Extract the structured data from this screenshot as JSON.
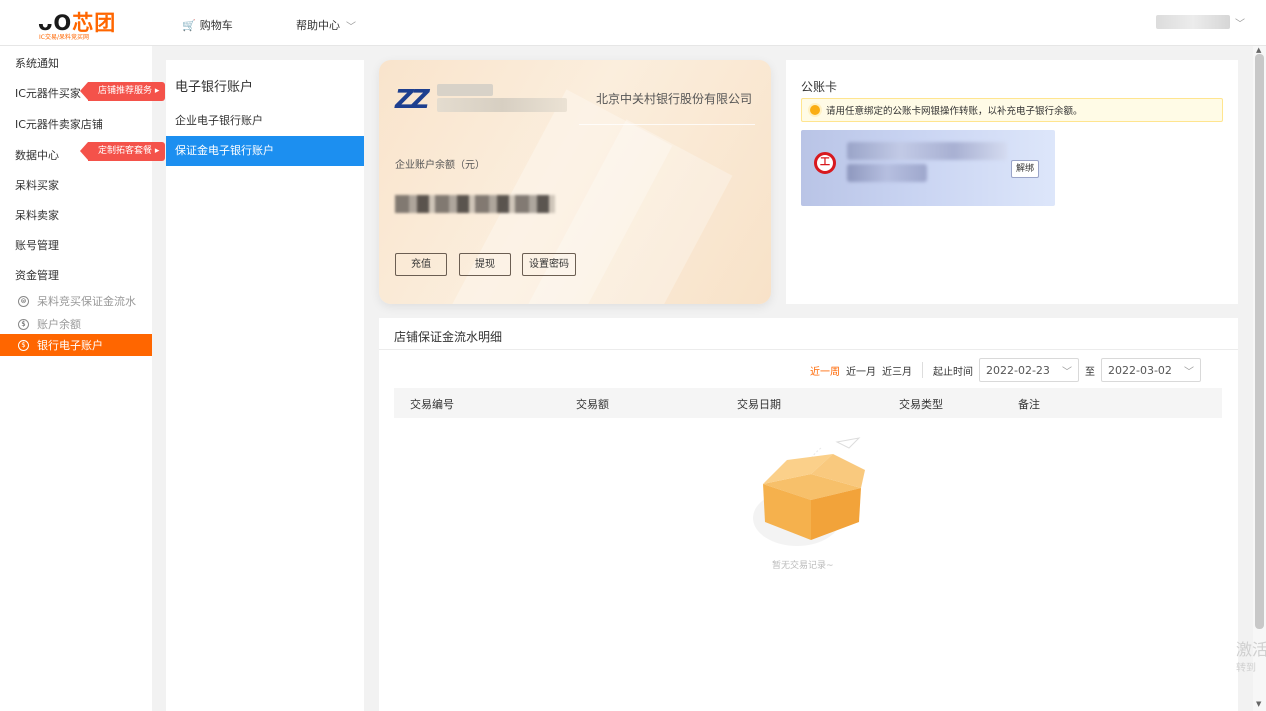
{
  "header": {
    "logo_text": "芯团",
    "logo_sub": "IC交易/呆料竞买网",
    "cart_label": "购物车",
    "help_label": "帮助中心"
  },
  "leftnav": {
    "items": [
      {
        "label": "系统通知"
      },
      {
        "label": "IC元器件买家",
        "tag": "店铺推荐服务 ▸"
      },
      {
        "label": "IC元器件卖家店铺"
      },
      {
        "label": "数据中心",
        "tag": "定制拓客套餐 ▸"
      },
      {
        "label": "呆料买家"
      },
      {
        "label": "呆料卖家"
      },
      {
        "label": "账号管理"
      },
      {
        "label": "资金管理"
      }
    ],
    "sub_items": [
      {
        "label": "呆料竞买保证金流水"
      },
      {
        "label": "账户余额"
      },
      {
        "label": "银行电子账户"
      }
    ]
  },
  "midpanel": {
    "title": "电子银行账户",
    "items": [
      {
        "label": "企业电子银行账户"
      },
      {
        "label": "保证金电子银行账户"
      }
    ]
  },
  "bankcard": {
    "bank_name": "北京中关村银行股份有限公司",
    "balance_label": "企业账户余额（元）",
    "buttons": [
      "充值",
      "提现",
      "设置密码"
    ]
  },
  "public_account": {
    "title": "公账卡",
    "notice": "请用任意绑定的公账卡网银操作转账，以补充电子银行余额。",
    "unbind_label": "解绑"
  },
  "detail": {
    "title": "店铺保证金流水明细",
    "quick_filters": [
      "近一周",
      "近一月",
      "近三月"
    ],
    "range_label": "起止时间",
    "start_date": "2022-02-23",
    "to_label": "至",
    "end_date": "2022-03-02",
    "columns": [
      "交易编号",
      "交易额",
      "交易日期",
      "交易类型",
      "备注"
    ],
    "empty_text": "暂无交易记录~"
  },
  "watermark": {
    "line1": "激活",
    "line2": "转到"
  },
  "colors": {
    "accent": "#ff6600",
    "primary_blue": "#1c8ff0",
    "tag_red": "#f4524a"
  }
}
